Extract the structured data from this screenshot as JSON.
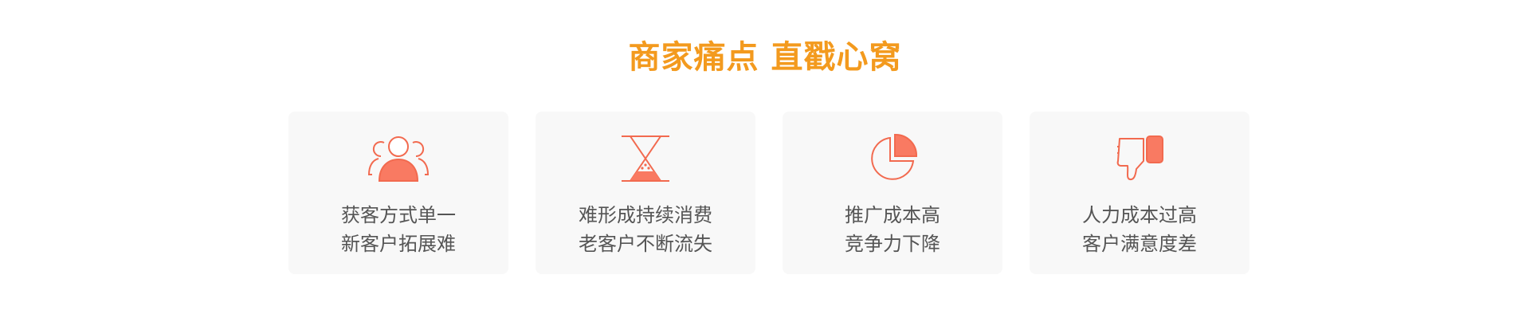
{
  "section": {
    "title": "商家痛点 直戳心窝",
    "accent_color": "#f39a1e",
    "icon_color": "#f26a4f"
  },
  "cards": [
    {
      "icon": "users-icon",
      "line1": "获客方式单一",
      "line2": "新客户拓展难"
    },
    {
      "icon": "hourglass-icon",
      "line1": "难形成持续消费",
      "line2": "老客户不断流失"
    },
    {
      "icon": "pie-chart-icon",
      "line1": "推广成本高",
      "line2": "竞争力下降"
    },
    {
      "icon": "thumbs-down-icon",
      "line1": "人力成本过高",
      "line2": "客户满意度差"
    }
  ]
}
